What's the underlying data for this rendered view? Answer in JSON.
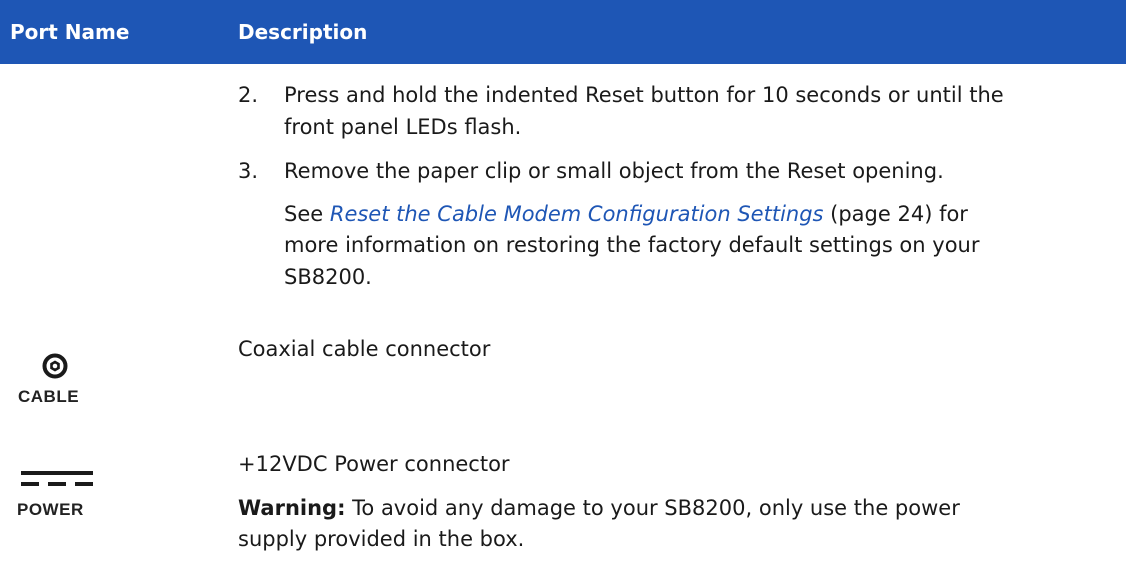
{
  "header": {
    "port_name": "Port Name",
    "description": "Description"
  },
  "steps": [
    {
      "num": "2.",
      "line1": "Press and hold the indented Reset button for 10 seconds or until the",
      "line2": "front panel LEDs flash."
    },
    {
      "num": "3.",
      "line1": "Remove the paper clip or small object from the Reset opening."
    }
  ],
  "see_note": {
    "prefix": "See ",
    "link": "Reset the Cable Modem Configuration Settings",
    "suffix": " (page 24) for",
    "line2": "more information on restoring the factory default settings on your",
    "line3": "SB8200."
  },
  "ports": [
    {
      "icon": "coaxial-cable-icon",
      "label": "CABLE",
      "description": "Coaxial cable connector"
    },
    {
      "icon": "dc-power-icon",
      "label": "POWER",
      "description": "+12VDC Power connector",
      "warning_label": "Warning:",
      "warning_line1": " To avoid any damage to your SB8200, only use the power",
      "warning_line2": "supply provided in the box."
    }
  ]
}
